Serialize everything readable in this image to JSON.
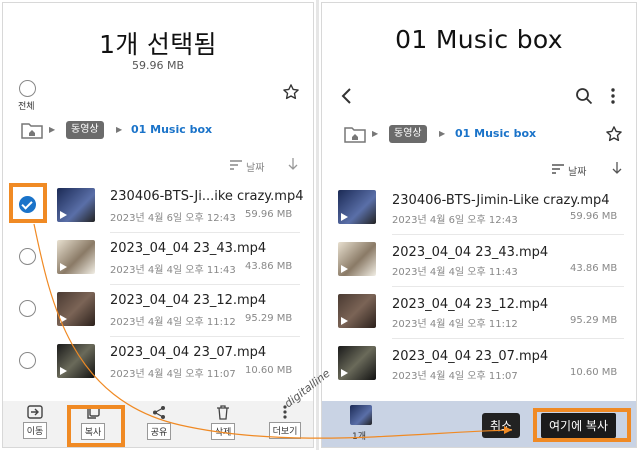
{
  "left": {
    "title": "1개 선택됨",
    "subtitle": "59.96 MB",
    "select_all_label": "전체",
    "breadcrumb": {
      "folder": "동영상",
      "current": "01 Music box"
    },
    "sort_label": "날짜",
    "files": [
      {
        "name": "230406-BTS-Ji...ike crazy.mp4",
        "meta": "2023년 4월 6일 오후 12:43",
        "size": "59.96 MB",
        "selected": true
      },
      {
        "name": "2023_04_04 23_43.mp4",
        "meta": "2023년 4월 4일 오후 11:43",
        "size": "43.86 MB",
        "selected": false
      },
      {
        "name": "2023_04_04 23_12.mp4",
        "meta": "2023년 4월 4일 오후 11:12",
        "size": "95.29 MB",
        "selected": false
      },
      {
        "name": "2023_04_04 23_07.mp4",
        "meta": "2023년 4월 4일 오후 11:07",
        "size": "10.60 MB",
        "selected": false
      }
    ],
    "bottom_actions": [
      {
        "label": "이동",
        "icon": "move-icon"
      },
      {
        "label": "복사",
        "icon": "copy-icon"
      },
      {
        "label": "공유",
        "icon": "share-icon"
      },
      {
        "label": "삭제",
        "icon": "delete-icon"
      },
      {
        "label": "더보기",
        "icon": "more-icon"
      }
    ]
  },
  "right": {
    "title": "01 Music box",
    "breadcrumb": {
      "folder": "동영상",
      "current": "01 Music box"
    },
    "sort_label": "날짜",
    "files": [
      {
        "name": "230406-BTS-Jimin-Like crazy.mp4",
        "meta": "2023년 4월 6일 오후 12:43",
        "size": "59.96 MB"
      },
      {
        "name": "2023_04_04 23_43.mp4",
        "meta": "2023년 4월 4일 오후 11:43",
        "size": "43.86 MB"
      },
      {
        "name": "2023_04_04 23_12.mp4",
        "meta": "2023년 4월 4일 오후 11:12",
        "size": "95.29 MB"
      },
      {
        "name": "2023_04_04 23_07.mp4",
        "meta": "2023년 4월 4일 오후 11:07",
        "size": "10.60 MB"
      }
    ],
    "clipboard_count": "1개",
    "cancel_label": "취소",
    "paste_label": "여기에 복사"
  },
  "watermark": "digitalline",
  "colors": {
    "accent": "#1a73c9",
    "highlight": "#f08a24"
  }
}
